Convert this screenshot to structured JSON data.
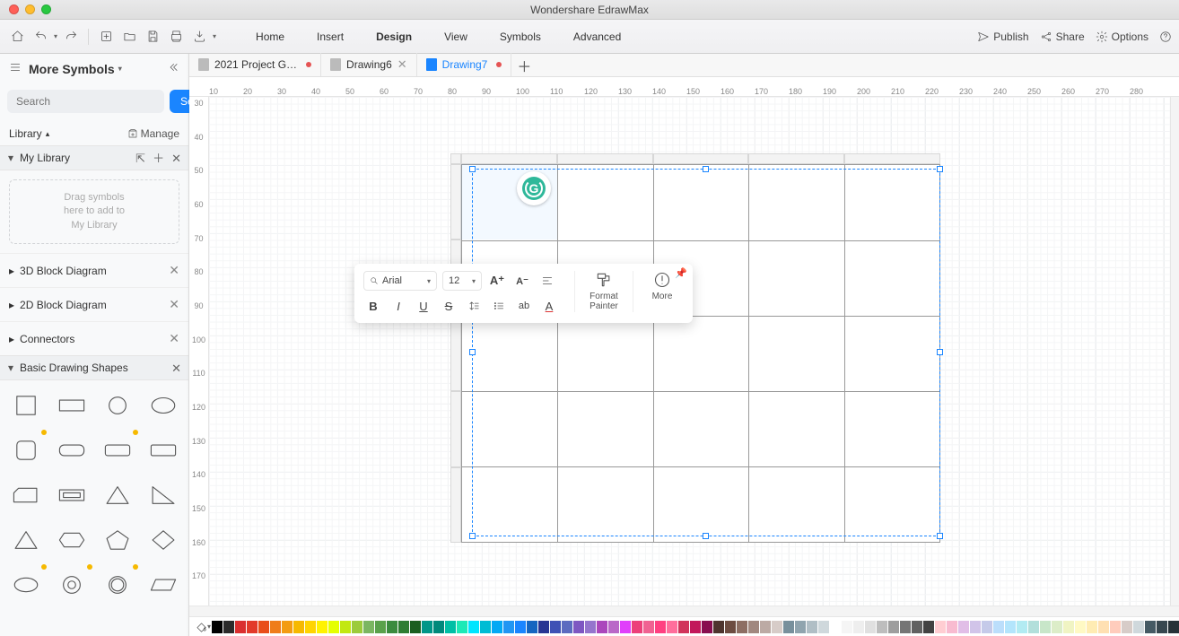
{
  "app": {
    "title": "Wondershare EdrawMax"
  },
  "menu": {
    "items": [
      "Home",
      "Insert",
      "Design",
      "View",
      "Symbols",
      "Advanced"
    ],
    "active": "Design"
  },
  "rightTools": {
    "publish": "Publish",
    "share": "Share",
    "options": "Options"
  },
  "sidebar": {
    "title": "More Symbols",
    "searchPlaceholder": "Search",
    "searchBtn": "Search",
    "library": "Library",
    "manage": "Manage",
    "myLibrary": "My Library",
    "dragHint": "Drag symbols\nhere to add to\nMy Library",
    "sections": [
      {
        "name": "3D Block Diagram",
        "expanded": false
      },
      {
        "name": "2D Block Diagram",
        "expanded": false
      },
      {
        "name": "Connectors",
        "expanded": false
      },
      {
        "name": "Basic Drawing Shapes",
        "expanded": true
      }
    ]
  },
  "tabs": [
    {
      "label": "2021 Project G…",
      "dirty": true,
      "active": false,
      "closeable": false
    },
    {
      "label": "Drawing6",
      "dirty": false,
      "active": false,
      "closeable": true
    },
    {
      "label": "Drawing7",
      "dirty": true,
      "active": true,
      "closeable": false
    }
  ],
  "ruler": {
    "h": [
      "10",
      "20",
      "30",
      "40",
      "50",
      "60",
      "70",
      "80",
      "90",
      "100",
      "110",
      "120",
      "130",
      "140",
      "150",
      "160",
      "170",
      "180",
      "190",
      "200",
      "210",
      "220",
      "230",
      "240",
      "250",
      "260",
      "270",
      "280"
    ],
    "v": [
      "30",
      "40",
      "50",
      "60",
      "70",
      "80",
      "90",
      "100",
      "110",
      "120",
      "130",
      "140",
      "150",
      "160",
      "170"
    ]
  },
  "formatPopup": {
    "font": "Arial",
    "size": "12",
    "painter": "Format\nPainter",
    "more": "More"
  },
  "palette": [
    "#000000",
    "#2b2b2b",
    "#da2f2f",
    "#e23a2a",
    "#e94e1b",
    "#ef7d1a",
    "#f39c12",
    "#f6b900",
    "#ffd400",
    "#fff200",
    "#e5ff00",
    "#c2e812",
    "#9ccb3b",
    "#7bb661",
    "#5aa14b",
    "#3b8b3e",
    "#2e7d32",
    "#1b5e20",
    "#009688",
    "#00897b",
    "#00bfa5",
    "#1de9b6",
    "#00e5ff",
    "#00bcd4",
    "#03a9f4",
    "#2196f3",
    "#1a85ff",
    "#1565c0",
    "#283593",
    "#3f51b5",
    "#5c6bc0",
    "#7e57c2",
    "#9575cd",
    "#ab47bc",
    "#ba68c8",
    "#e040fb",
    "#ec407a",
    "#f06292",
    "#ff4081",
    "#ff6e9c",
    "#d1345b",
    "#c2185b",
    "#880e4f",
    "#4e342e",
    "#6d4c41",
    "#8d6e63",
    "#a1887f",
    "#bcaaa4",
    "#d7ccc8",
    "#78909c",
    "#90a4ae",
    "#b0bec5",
    "#cfd8dc",
    "#ffffff",
    "#f5f5f5",
    "#eeeeee",
    "#e0e0e0",
    "#bdbdbd",
    "#9e9e9e",
    "#757575",
    "#616161",
    "#424242",
    "#ffcdd2",
    "#f8bbd0",
    "#e1bee7",
    "#d1c4e9",
    "#c5cae9",
    "#bbdefb",
    "#b3e5fc",
    "#b2ebf2",
    "#b2dfdb",
    "#c8e6c9",
    "#dcedc8",
    "#f0f4c3",
    "#fff9c4",
    "#ffecb3",
    "#ffe0b2",
    "#ffccbc",
    "#d7ccc8",
    "#cfd8dc",
    "#455a64",
    "#37474f",
    "#263238"
  ]
}
